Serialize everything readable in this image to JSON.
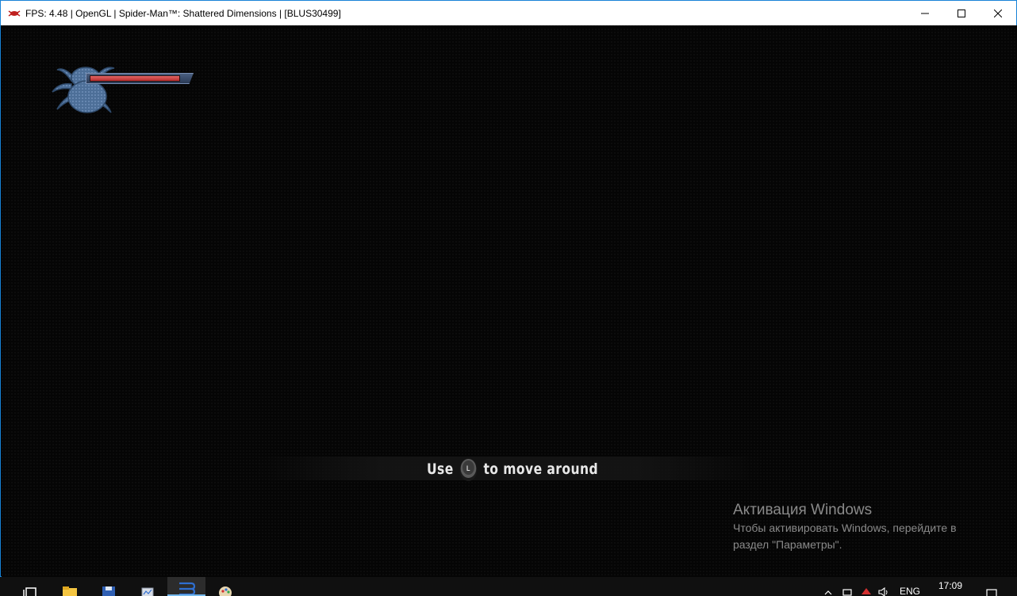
{
  "window": {
    "title": "FPS: 4.48 | OpenGL | Spider-Man™: Shattered Dimensions | [BLUS30499]",
    "buttons": [
      "minimize",
      "maximize",
      "close"
    ]
  },
  "hud": {
    "health_fraction": 0.92,
    "health_color": "#d04040"
  },
  "hint": {
    "before": "Use",
    "icon": "left-stick-icon",
    "after": "to move around"
  },
  "activation": {
    "title": "Активация Windows",
    "line1": "Чтобы активировать Windows, перейдите в",
    "line2": "раздел \"Параметры\"."
  },
  "taskbar": {
    "items": [
      "task-view-icon",
      "file-explorer-icon",
      "save-app-icon",
      "system-monitor-icon",
      "rpcs3-icon",
      "paint-icon"
    ],
    "active_index": 4,
    "tray": {
      "language": "ENG",
      "time": "17:09"
    }
  },
  "colors": {
    "titlebar_bg": "#ffffff",
    "window_border": "#1883d7",
    "taskbar_bg": "#101010",
    "watermark": "#8a8a8a"
  }
}
